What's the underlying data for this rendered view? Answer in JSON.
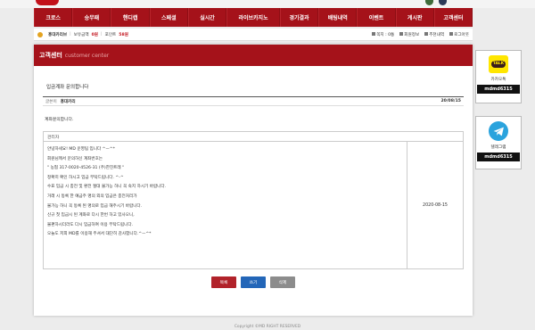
{
  "colors": {
    "brand": "#a5121a",
    "write_button": "#2366b8",
    "delete_button": "#8c8c8c",
    "kakao": "#ffe600",
    "telegram": "#2aa3dd"
  },
  "nav": {
    "items": [
      "크로스",
      "승무패",
      "핸디캡",
      "스페셜",
      "실시간",
      "라이브카지노",
      "경기결과",
      "배팅내역",
      "이벤트",
      "게시판",
      "고객센터"
    ]
  },
  "userbar": {
    "username": "홍대카리브",
    "balance_label": "보유금액",
    "balance_value": "0원",
    "point_label": "포인트",
    "point_value": "58원",
    "links": [
      "쪽지 : 0통",
      "회원정보",
      "추천내역",
      "로그아웃"
    ]
  },
  "page": {
    "title": "고객센터",
    "subtitle": "customer center"
  },
  "post": {
    "title": "입금계좌 문의합니다",
    "author_label": "글쓴이",
    "author": "홍대카리",
    "date": "20/08/15",
    "body": "계좌문의합니다."
  },
  "reply": {
    "header": "관리자",
    "lines": [
      "안녕하세요! MD 운영팀 입니다 ^ㅡ^*",
      "회원님께서 문의하신 계좌번호는",
      "\" 농협 317-0020-4526-31 (주)한진트레 \"",
      "정확히 확인 하시고 입금 부탁드립니다. ^-^",
      "수표 입금 시 충전 및 환전 절대 불가능 하니 꼭 숙지 하시기 바랍니다.",
      "거래 시 동록 한 예금주 명의 외의 입금은 충전처리가",
      "불가능 하니 꼭 동록 된 명의로 입금 해주시기 바랍니다.",
      "신규 첫 입금시 된 계좌로 다시 한번 하고 있사오니,",
      "불편하시더라도 다시 입금하여 이용 부탁드립니다.",
      "오늘도 저희 MD를 이용해 주셔서 대단히 감사합니다.^ㅡ^*"
    ],
    "date": "2020-08-15"
  },
  "buttons": {
    "list": "목록",
    "write": "쓰기",
    "delete": "삭제"
  },
  "sidebar": {
    "kakao": {
      "icon_text": "TALK",
      "label": "카카오톡",
      "id": "mdmd6315",
      "icon": "kakaotalk-icon"
    },
    "telegram": {
      "label": "텔레그램",
      "id": "mdmd6315",
      "icon": "telegram-icon"
    }
  },
  "footer": "Copyright ©MD RIGHT RESERVED"
}
